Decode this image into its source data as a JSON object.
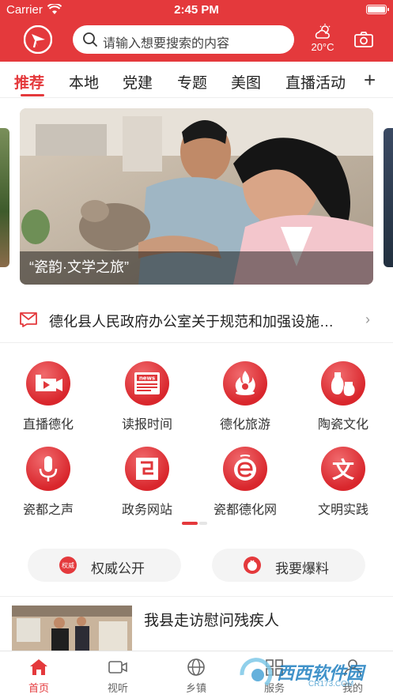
{
  "status_bar": {
    "carrier": "Carrier",
    "time": "2:45 PM"
  },
  "header": {
    "search_placeholder": "请输入想要搜索的内容",
    "weather_temp": "20°C"
  },
  "tabs": [
    "推荐",
    "本地",
    "党建",
    "专题",
    "美图",
    "直播活动"
  ],
  "active_tab": "推荐",
  "banner": {
    "caption": "“瓷韵·文学之旅”"
  },
  "notice": {
    "text": "德化县人民政府办公室关于规范和加强设施…"
  },
  "grid": [
    {
      "label": "直播德化",
      "icon": "video-camera-icon"
    },
    {
      "label": "读报时间",
      "icon": "newspaper-icon"
    },
    {
      "label": "德化旅游",
      "icon": "flame-icon"
    },
    {
      "label": "陶瓷文化",
      "icon": "vase-icon"
    },
    {
      "label": "瓷都之声",
      "icon": "microphone-icon"
    },
    {
      "label": "政务网站",
      "icon": "gov-site-icon"
    },
    {
      "label": "瓷都德化网",
      "icon": "web-e-icon"
    },
    {
      "label": "文明实践",
      "icon": "wen-char-icon"
    }
  ],
  "grid_icon_glyphs": {
    "wen": "文",
    "news": "news"
  },
  "pills": [
    {
      "label": "权威公开",
      "icon_text": "权威"
    },
    {
      "label": "我要爆料",
      "icon": "tomato-icon"
    }
  ],
  "news": {
    "title": "我县走访慰问残疾人"
  },
  "bottom_nav": [
    {
      "label": "首页",
      "icon": "home-icon"
    },
    {
      "label": "视听",
      "icon": "video-icon"
    },
    {
      "label": "乡镇",
      "icon": "globe-icon"
    },
    {
      "label": "服务",
      "icon": "service-icon"
    },
    {
      "label": "我的",
      "icon": "user-icon"
    }
  ],
  "watermark": {
    "text": "西西软件园",
    "sub": "CR173.COM"
  },
  "colors": {
    "brand_red": "#e4393c",
    "text_dark": "#222222"
  }
}
